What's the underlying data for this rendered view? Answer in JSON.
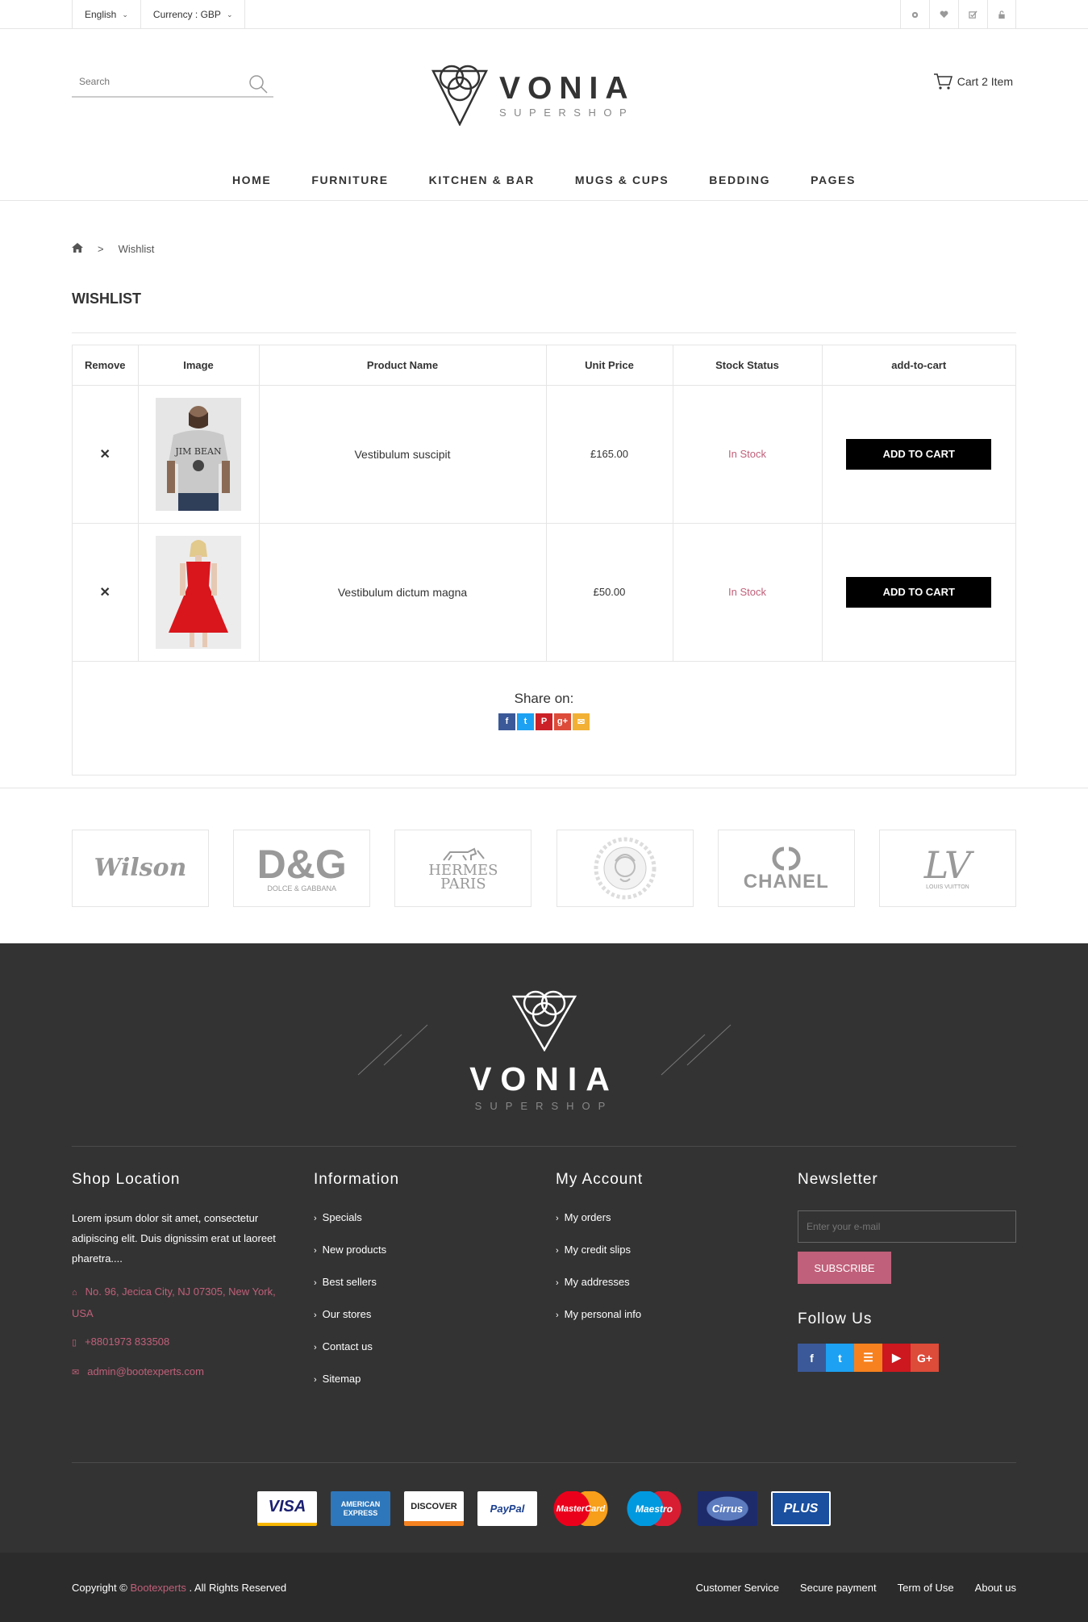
{
  "topbar": {
    "language": "English",
    "currency": "Currency : GBP",
    "icons": [
      "gear-icon",
      "heart-icon",
      "check-square-icon",
      "lock-icon"
    ]
  },
  "header": {
    "search_placeholder": "Search",
    "logo_title": "VONIA",
    "logo_sub": "SUPERSHOP",
    "cart_label": "Cart 2 Item"
  },
  "nav": [
    "HOME",
    "FURNITURE",
    "KITCHEN & BAR",
    "MUGS & CUPS",
    "BEDDING",
    "PAGES"
  ],
  "breadcrumb": {
    "sep": ">",
    "current": "Wishlist"
  },
  "page_title": "WISHLIST",
  "table": {
    "headers": [
      "Remove",
      "Image",
      "Product Name",
      "Unit Price",
      "Stock Status",
      "add-to-cart"
    ],
    "rows": [
      {
        "name": "Vestibulum suscipit",
        "price": "£165.00",
        "stock": "In Stock",
        "button": "ADD TO CART",
        "remove": "✕"
      },
      {
        "name": "Vestibulum dictum magna",
        "price": "£50.00",
        "stock": "In Stock",
        "button": "ADD TO CART",
        "remove": "✕"
      }
    ]
  },
  "share": {
    "title": "Share on:",
    "icons": [
      {
        "glyph": "f",
        "color": "#3b5998"
      },
      {
        "glyph": "t",
        "color": "#1da1f2"
      },
      {
        "glyph": "P",
        "color": "#cb2027"
      },
      {
        "glyph": "g+",
        "color": "#dd4b39"
      },
      {
        "glyph": "✉",
        "color": "#f2b134"
      }
    ]
  },
  "brands": [
    "Wilson",
    "D&G",
    "HERMES PARIS",
    "Versace",
    "CHANEL",
    "LV"
  ],
  "brand_subs": [
    "",
    "DOLCE & GABBANA",
    "",
    "",
    "",
    "LOUIS VUITTON"
  ],
  "footer": {
    "logo_title": "VONIA",
    "logo_sub": "SUPERSHOP",
    "shop_location": {
      "title": "Shop Location",
      "desc": "Lorem ipsum dolor sit amet, consectetur adipiscing elit. Duis dignissim erat ut laoreet pharetra....",
      "address": "No. 96, Jecica City, NJ 07305, New York, USA",
      "phone": "+8801973 833508",
      "email": "admin@bootexperts.com"
    },
    "information": {
      "title": "Information",
      "items": [
        "Specials",
        "New products",
        "Best sellers",
        "Our stores",
        "Contact us",
        "Sitemap"
      ]
    },
    "account": {
      "title": "My Account",
      "items": [
        "My orders",
        "My credit slips",
        "My addresses",
        "My personal info"
      ]
    },
    "newsletter": {
      "title": "Newsletter",
      "placeholder": "Enter your e-mail",
      "button": "SUBSCRIBE",
      "follow": "Follow Us",
      "social": [
        {
          "glyph": "f",
          "color": "#3b5998"
        },
        {
          "glyph": "t",
          "color": "#1da1f2"
        },
        {
          "glyph": "☰",
          "color": "#f7811e"
        },
        {
          "glyph": "▶",
          "color": "#cc181e"
        },
        {
          "glyph": "G+",
          "color": "#dd4b39"
        }
      ]
    },
    "payments": [
      "VISA",
      "AMERICAN EXPRESS",
      "DISCOVER",
      "PayPal",
      "MasterCard",
      "Maestro",
      "Cirrus",
      "PLUS"
    ]
  },
  "bottom": {
    "copy_pre": "Copyright ©",
    "copy_brand": "Bootexperts",
    "copy_post": ". All Rights Reserved",
    "links": [
      "Customer Service",
      "Secure payment",
      "Term of Use",
      "About us"
    ]
  }
}
